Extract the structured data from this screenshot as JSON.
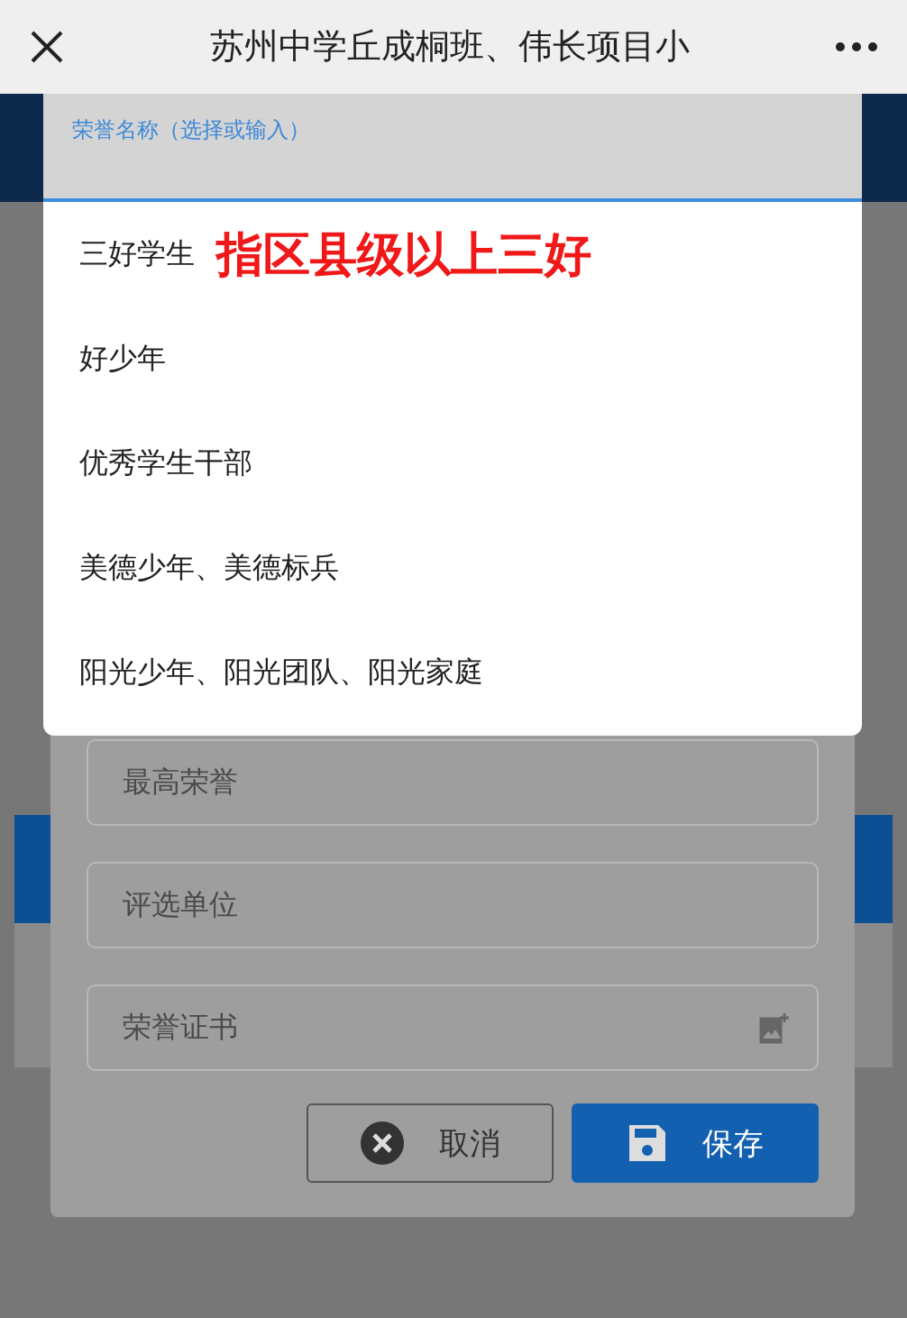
{
  "top_bar": {
    "title": "苏州中学丘成桐班、伟长项目小"
  },
  "dialog": {
    "fields": [
      {
        "placeholder": "最高荣誉",
        "kind": "text"
      },
      {
        "placeholder": "评选单位",
        "kind": "text"
      },
      {
        "placeholder": "荣誉证书",
        "kind": "image"
      }
    ],
    "buttons": [
      {
        "label": "取消",
        "kind": "cancel"
      },
      {
        "label": "保存",
        "kind": "save"
      }
    ]
  },
  "dropdown": {
    "label": "荣誉名称（选择或输入）",
    "options": [
      {
        "label": "三好学生",
        "note": "指区县级以上三好"
      },
      {
        "label": "好少年"
      },
      {
        "label": "优秀学生干部"
      },
      {
        "label": "美德少年、美德标兵"
      },
      {
        "label": "阳光少年、阳光团队、阳光家庭"
      }
    ]
  }
}
